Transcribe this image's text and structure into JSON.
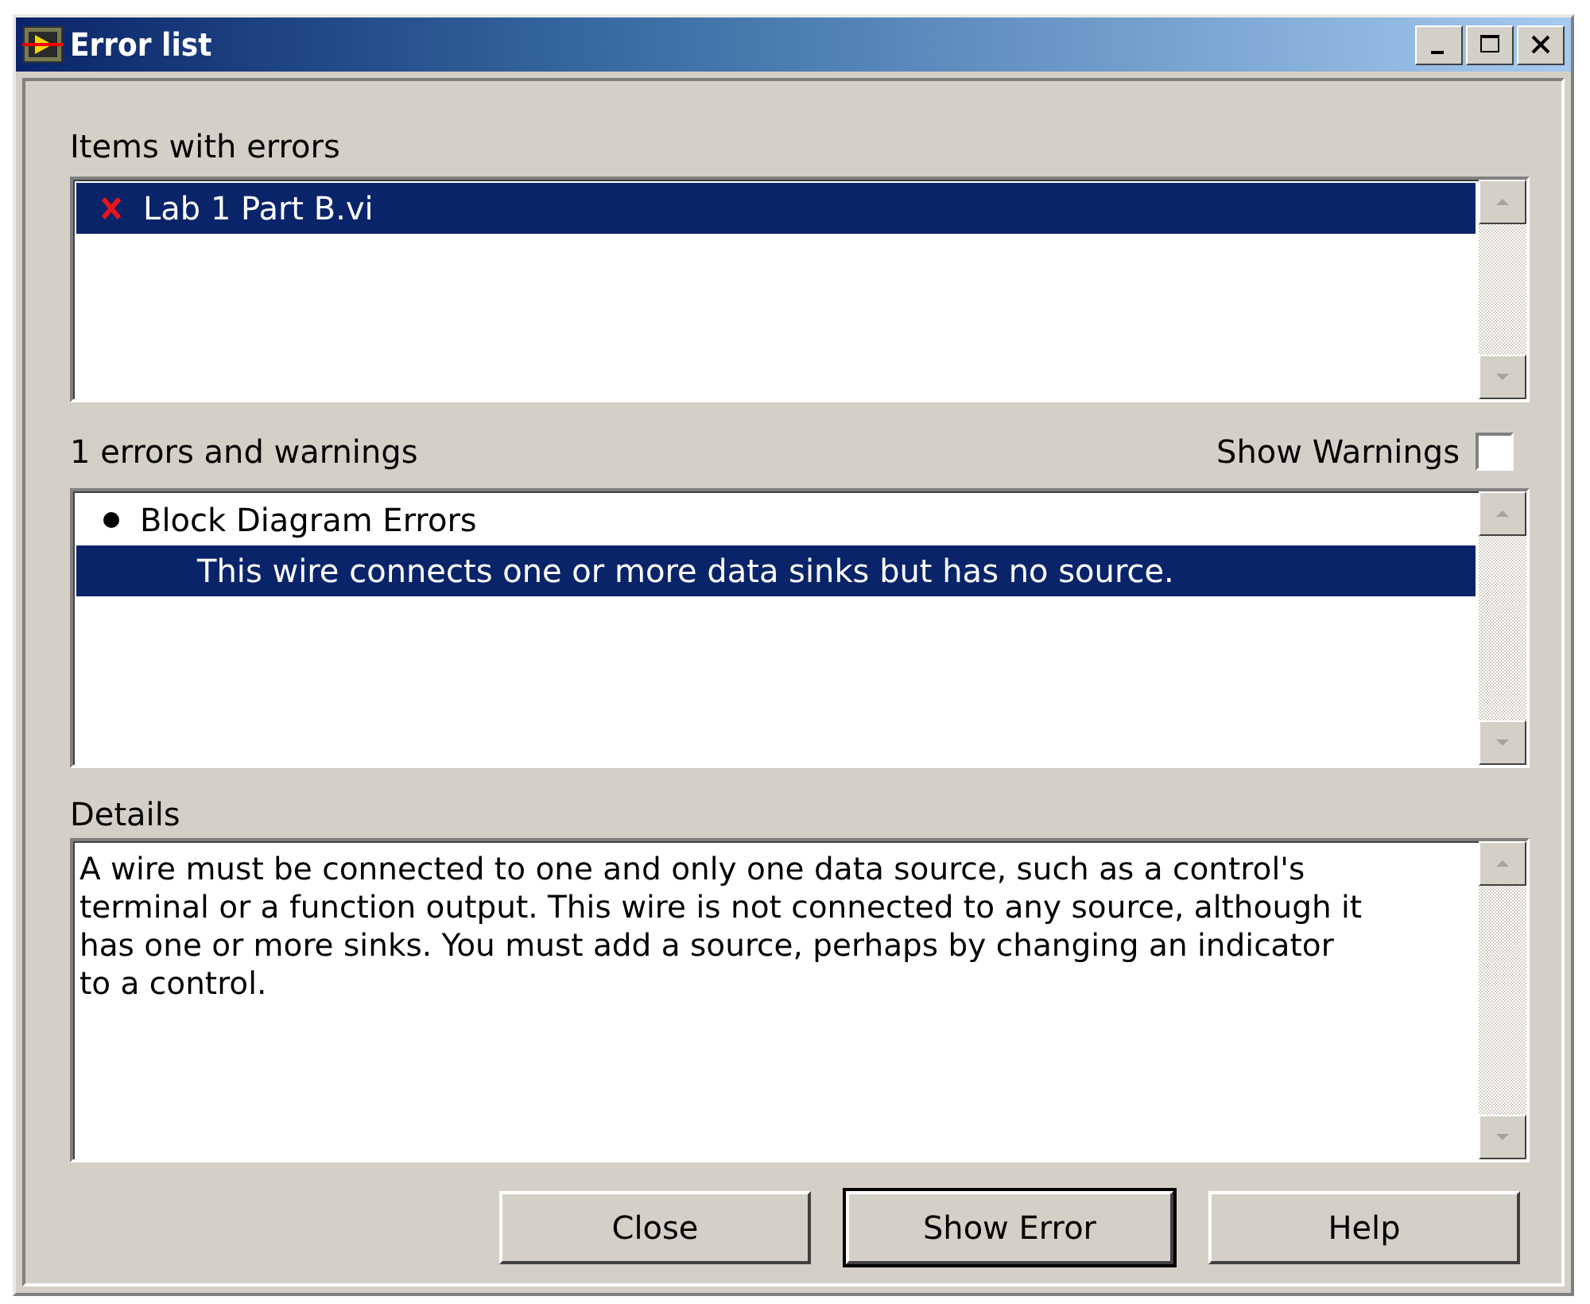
{
  "window": {
    "title": "Error list"
  },
  "items_label": "Items with errors",
  "items": [
    {
      "name": "Lab 1 Part B.vi",
      "selected": true
    }
  ],
  "count_label": "1 errors and warnings",
  "show_warnings": {
    "label": "Show Warnings",
    "checked": false
  },
  "errors": [
    {
      "label": "Block Diagram Errors",
      "selected": false,
      "children": [
        {
          "label": "This wire connects one or more data sinks but has no source.",
          "selected": true
        }
      ]
    }
  ],
  "details_label": "Details",
  "details": "A wire must be connected to one and only one data source, such as a control's terminal or a function output. This wire is not connected to any source, although it has one or more sinks.  You must add a source, perhaps by changing an indicator to a control.",
  "buttons": [
    {
      "label": "Close",
      "default": false
    },
    {
      "label": "Show Error",
      "default": true
    },
    {
      "label": "Help",
      "default": false
    }
  ]
}
